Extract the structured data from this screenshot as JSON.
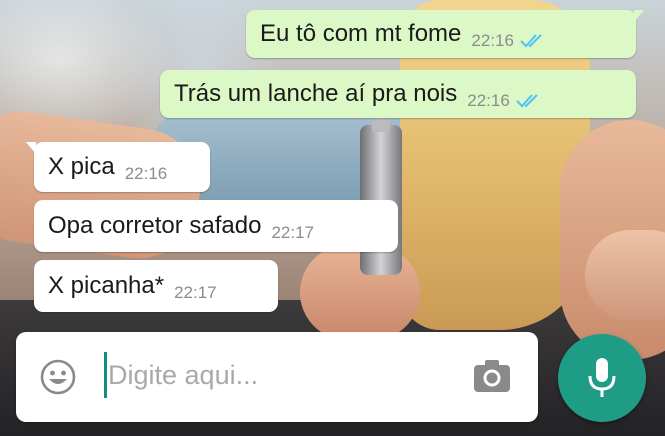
{
  "colors": {
    "outgoing_bubble": "#dcf8c6",
    "incoming_bubble": "#ffffff",
    "read_ticks": "#4fc3f7",
    "accent": "#1f9c86"
  },
  "messages": [
    {
      "direction": "outgoing",
      "text": "Eu tô com mt fome",
      "time": "22:16",
      "status": "read"
    },
    {
      "direction": "outgoing",
      "text": "Trás um lanche aí pra nois",
      "time": "22:16",
      "status": "read"
    },
    {
      "direction": "incoming",
      "text": "X pica",
      "time": "22:16"
    },
    {
      "direction": "incoming",
      "text": "Opa corretor safado",
      "time": "22:17"
    },
    {
      "direction": "incoming",
      "text": "X picanha*",
      "time": "22:17"
    }
  ],
  "composer": {
    "placeholder": "Digite aqui...",
    "emoji_icon": "emoji-icon",
    "camera_icon": "camera-icon",
    "mic_icon": "microphone-icon"
  }
}
